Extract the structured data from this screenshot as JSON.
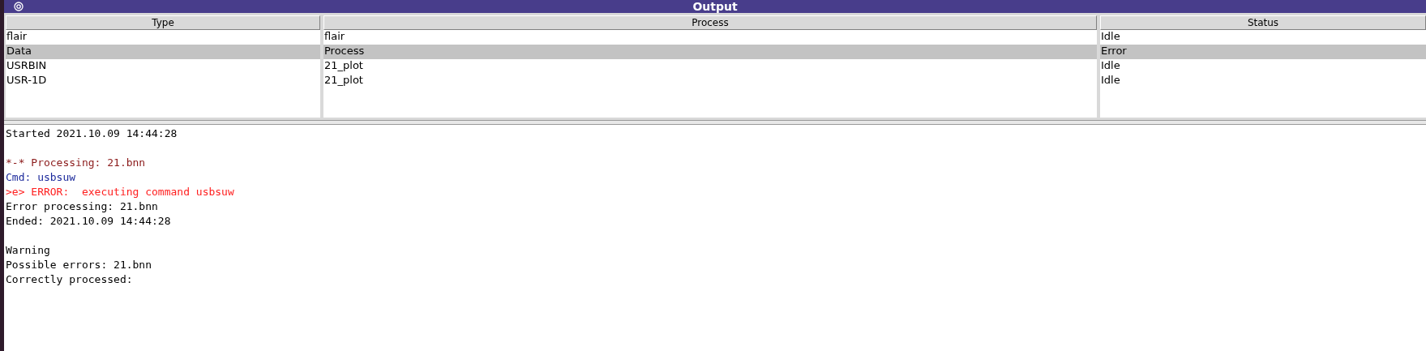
{
  "window": {
    "title": "Output"
  },
  "table": {
    "columns": [
      "Type",
      "Process",
      "Status"
    ],
    "rows": [
      {
        "cells": [
          "flair",
          "flair",
          "Idle"
        ],
        "selected": false
      },
      {
        "cells": [
          "Data",
          "Process",
          "Error"
        ],
        "selected": true
      },
      {
        "cells": [
          "USRBIN",
          "21_plot",
          "Idle"
        ],
        "selected": false
      },
      {
        "cells": [
          "USR-1D",
          "21_plot",
          "Idle"
        ],
        "selected": false
      }
    ]
  },
  "log": {
    "paragraphs": [
      [
        {
          "kind": "plain",
          "text": "Started 2021.10.09 14:44:28"
        }
      ],
      [
        {
          "kind": "heading",
          "text": "*-* Processing: 21.bnn"
        },
        {
          "kind": "command",
          "text": "Cmd: usbsuw"
        },
        {
          "kind": "error",
          "text": ">e> ERROR:  executing command usbsuw"
        },
        {
          "kind": "plain",
          "text": "Error processing: 21.bnn"
        },
        {
          "kind": "plain",
          "text": "Ended: 2021.10.09 14:44:28"
        }
      ],
      [
        {
          "kind": "plain",
          "text": "Warning"
        },
        {
          "kind": "plain",
          "text": "Possible errors: 21.bnn"
        },
        {
          "kind": "plain",
          "text": "Correctly processed:"
        }
      ]
    ]
  }
}
